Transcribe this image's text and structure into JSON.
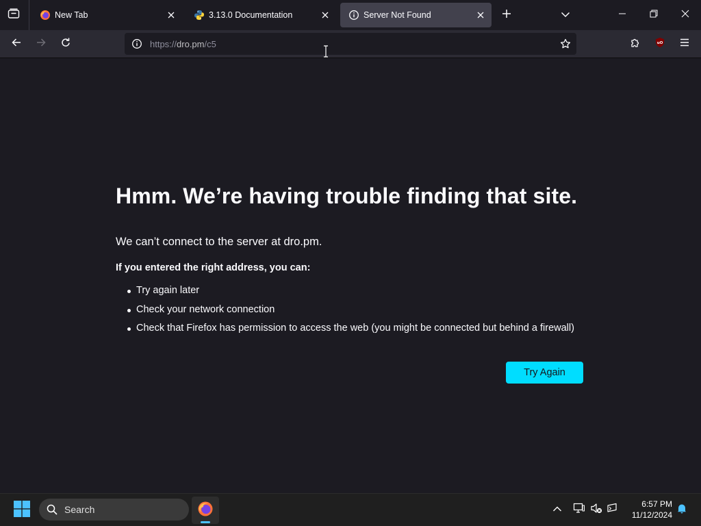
{
  "tabs": [
    {
      "label": "New Tab",
      "icon": "firefox-icon",
      "active": false
    },
    {
      "label": "3.13.0 Documentation",
      "icon": "python-icon",
      "active": false
    },
    {
      "label": "Server Not Found",
      "icon": "info-icon",
      "active": true
    }
  ],
  "urlbar": {
    "scheme": "https://",
    "host": "dro.pm",
    "path": "/c5"
  },
  "error": {
    "title": "Hmm. We’re having trouble finding that site.",
    "description": "We can’t connect to the server at dro.pm.",
    "hint": "If you entered the right address, you can:",
    "suggestions": [
      "Try again later",
      "Check your network connection",
      "Check that Firefox has permission to access the web (you might be connected but behind a firewall)"
    ],
    "button_label": "Try Again"
  },
  "taskbar": {
    "search_label": "Search",
    "time": "6:57 PM",
    "date": "11/12/2024"
  },
  "colors": {
    "page_bg": "#1c1b22",
    "toolbar_bg": "#2b2a33",
    "active_tab_bg": "#42414d",
    "accent_button": "#00ddff",
    "taskbar_bg": "#1f1f1f"
  }
}
